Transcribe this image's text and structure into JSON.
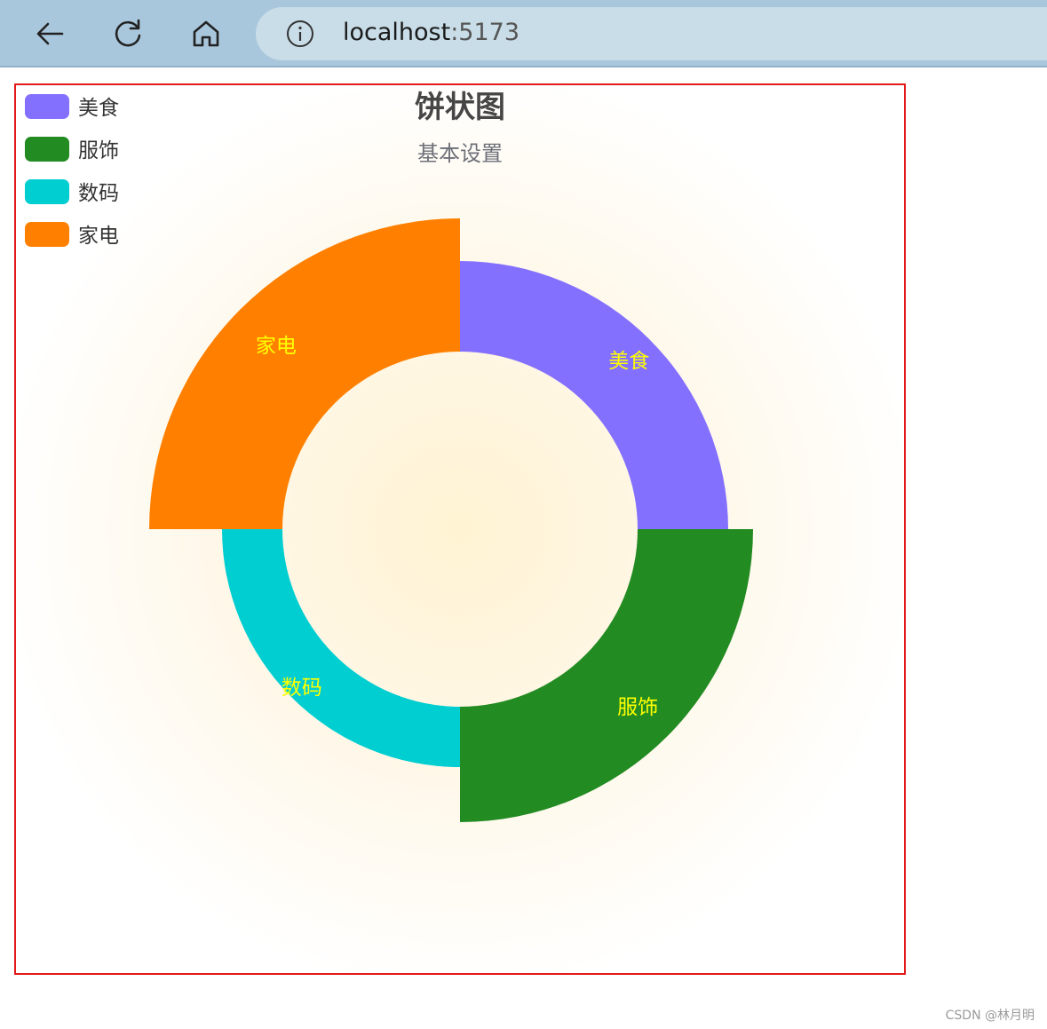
{
  "browser": {
    "url_host": "localhost",
    "url_port": ":5173"
  },
  "chart_data": {
    "type": "pie",
    "variant": "nightingale-rose-donut",
    "title": "饼状图",
    "subtitle": "基本设置",
    "categories": [
      "美食",
      "服饰",
      "数码",
      "家电"
    ],
    "values": [
      302,
      330,
      268,
      350
    ],
    "colors": [
      "#8470ff",
      "#228b22",
      "#00ced1",
      "#ff8000"
    ],
    "label_color": "#ffff00",
    "legend_position": "top-left",
    "background": "radial-gradient cream"
  },
  "watermark": "CSDN @林月明"
}
